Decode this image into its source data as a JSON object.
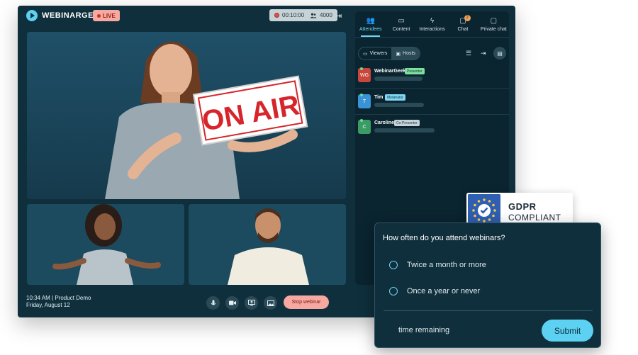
{
  "header": {
    "brand": "WEBINARGEEK",
    "live_label": "LIVE",
    "timer": "00:10:00",
    "viewer_count": "4000",
    "exit_icon": "exit-arrow-icon"
  },
  "panel": {
    "tabs": [
      {
        "label": "Attendees",
        "icon": "people-icon",
        "active": true
      },
      {
        "label": "Content",
        "icon": "folder-icon",
        "active": false
      },
      {
        "label": "Interactions",
        "icon": "lightning-icon",
        "active": false
      },
      {
        "label": "Chat",
        "icon": "chat-bubble-icon",
        "active": false,
        "badge": "2"
      },
      {
        "label": "Private chat",
        "icon": "private-chat-icon",
        "active": false
      }
    ],
    "filters": [
      {
        "label": "Viewers",
        "active": false
      },
      {
        "label": "Hosts",
        "active": true
      }
    ],
    "people": [
      {
        "initials": "WG",
        "name": "WebinarGeek",
        "role": "Presenter",
        "avatar_color": "#c8463c",
        "role_bg": "#7ee0a0",
        "role_fg": "#0d3a24"
      },
      {
        "initials": "T",
        "name": "Tim",
        "role": "Moderator",
        "avatar_color": "#3a93d6",
        "role_bg": "#7fd7f5",
        "role_fg": "#0b2f3c"
      },
      {
        "initials": "C",
        "name": "Caroline",
        "role": "Co-Presenter",
        "avatar_color": "#3b9b64",
        "role_bg": "#c5d2d8",
        "role_fg": "#1b3440"
      }
    ]
  },
  "footer": {
    "time": "10:34 AM | Product Demo",
    "date": "Friday, August 12",
    "controls": [
      "microphone-icon",
      "camera-icon",
      "screen-share-icon",
      "image-icon"
    ],
    "stop_label": "Stop webinar"
  },
  "video": {
    "sign_text": "ON AIR"
  },
  "poll": {
    "question": "How often do you attend webinars?",
    "options": [
      "Twice a month or more",
      "Once a year or never"
    ],
    "time_label": "time remaining",
    "submit_label": "Submit"
  },
  "gdpr": {
    "title": "GDPR",
    "subtitle": "COMPLIANT"
  },
  "colors": {
    "accent": "#5cd1f2",
    "live": "#f7a8a0",
    "background": "#0f2f3c"
  }
}
